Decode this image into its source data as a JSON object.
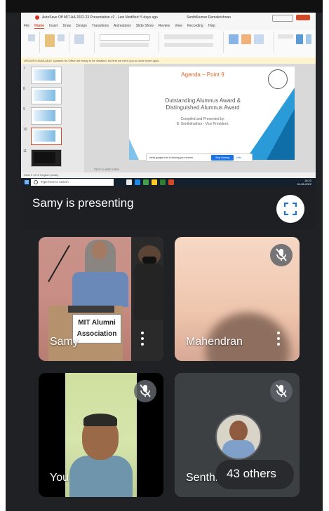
{
  "powerpoint": {
    "title_bar": "AutoSave  Off  MIT-AA 2022-23 Presentation v2 - Last Modified: 5 days ago",
    "user": "Senthilkumar Ramakrishnan",
    "comments_label": "Comments",
    "share_label": "Share",
    "ribbon_tabs": [
      "File",
      "Home",
      "Insert",
      "Draw",
      "Design",
      "Transitions",
      "Animations",
      "Slide Show",
      "Review",
      "View",
      "Recording",
      "Help"
    ],
    "notice": "UPDATES AVAILABLE  Updates for Office are ready to be installed, but first we need you to close some apps.",
    "slide_numbers": [
      "7",
      "8",
      "9",
      "10",
      "11"
    ],
    "notes_placeholder": "Click to add notes",
    "status": "Slide 9 of 19    English (India)",
    "slide": {
      "agenda": "Agenda – Point 9",
      "line1": "Outstanding Alumnus Award &",
      "line2": "Distinguished Alumnus Award",
      "compiled": "Compiled and Presented by:",
      "presenter": "B. Senthilnathan - Vice President."
    },
    "sharebar": {
      "text": "meet.google.com is sharing your screen.",
      "stop": "Stop sharing",
      "hide": "Hide"
    }
  },
  "taskbar": {
    "search_placeholder": "Type here to search",
    "time": "18:22",
    "date": "04-06-2022"
  },
  "presenting_label": "Samy is presenting",
  "tiles": {
    "samy": {
      "name": "Samy",
      "sign_line1": "MIT Alumni",
      "sign_line2": "Association"
    },
    "mahendran": {
      "name": "Mahendran"
    },
    "you": {
      "name": "You"
    },
    "others": {
      "name": "Senthil",
      "count_label": "43 others"
    }
  },
  "colors": {
    "meet_background": "#202124",
    "tile_background": "#3c4043",
    "ppt_accent": "#d24726",
    "slide_title": "#e0642a",
    "slide_blue": "#2a9bd8"
  },
  "icons": [
    "fullscreen-icon",
    "mic-off-icon",
    "more-vert-icon",
    "windows-start-icon",
    "search-icon"
  ]
}
